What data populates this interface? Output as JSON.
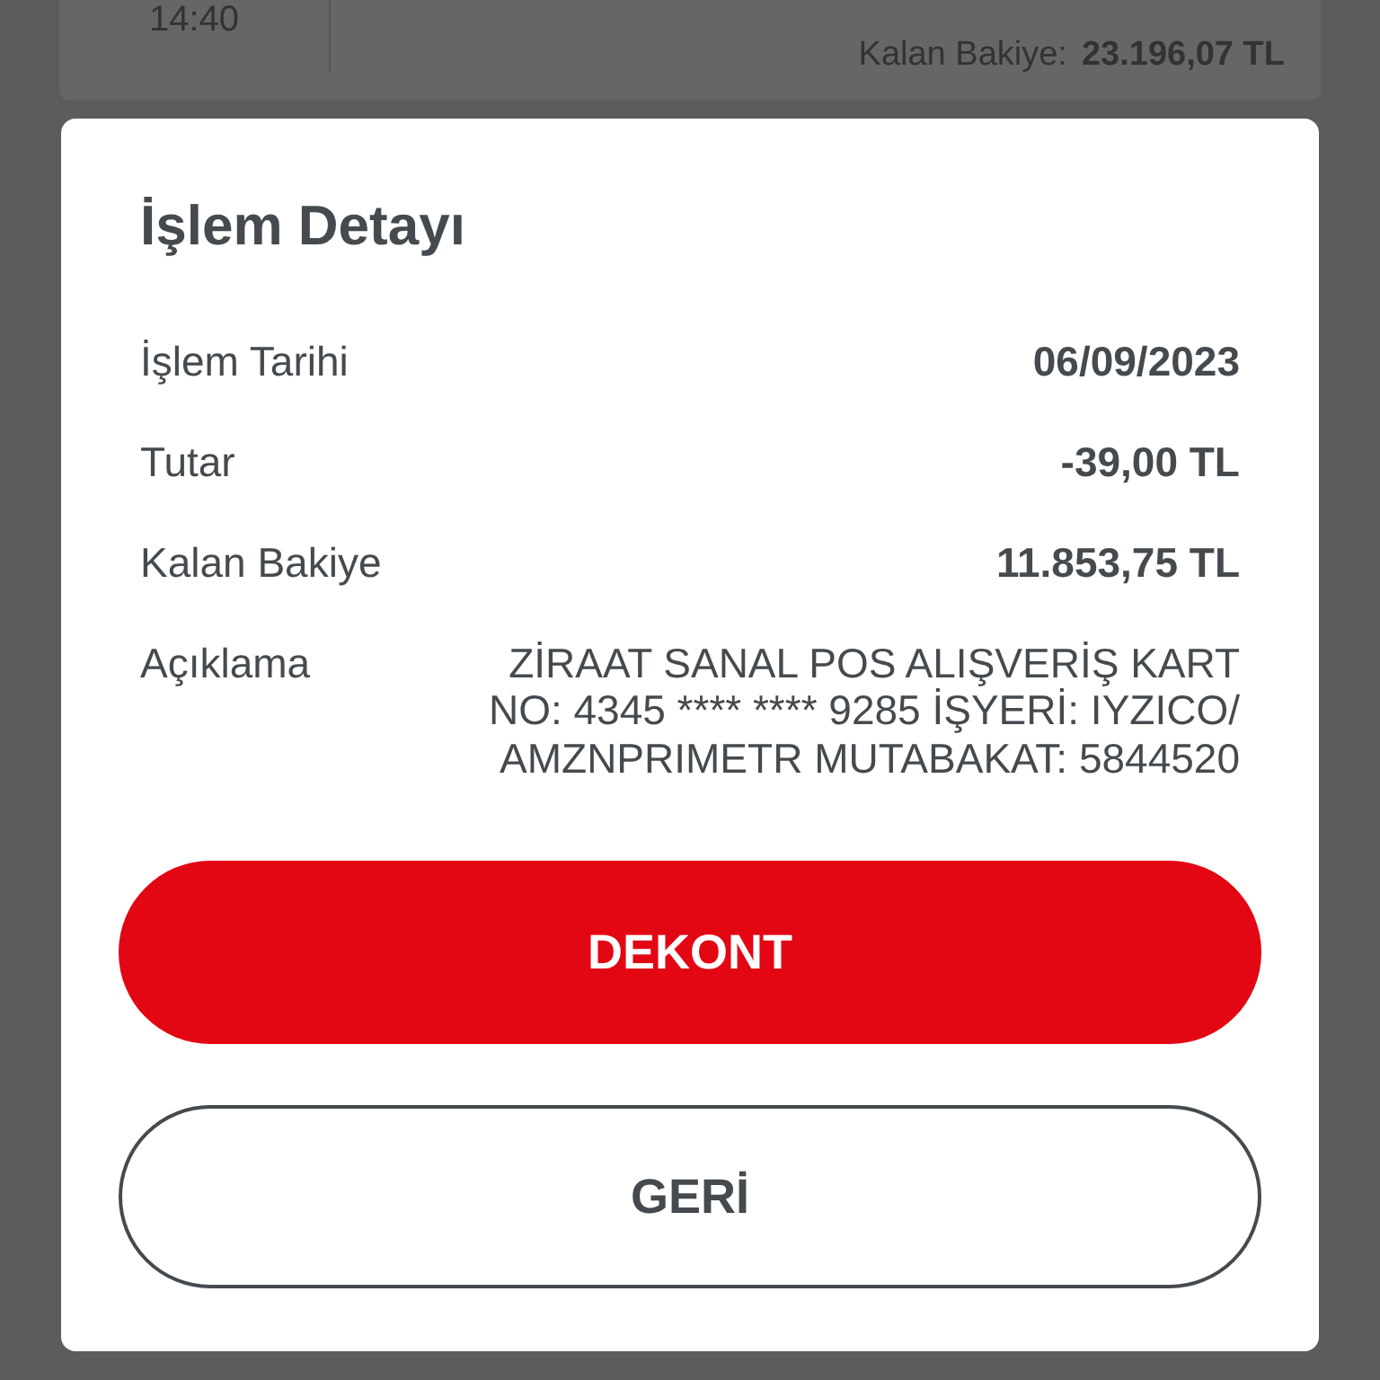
{
  "background_card": {
    "time": "14:40",
    "balance_label": "Kalan Bakiye:",
    "balance_value": "23.196,07 TL"
  },
  "dialog": {
    "title": "İşlem Detayı",
    "rows": [
      {
        "label": "İşlem Tarihi",
        "value": "06/09/2023",
        "kind": "bold"
      },
      {
        "label": "Tutar",
        "value": "-39,00 TL",
        "kind": "bold"
      },
      {
        "label": "Kalan Bakiye",
        "value": "11.853,75 TL",
        "kind": "bold"
      },
      {
        "label": "Açıklama",
        "value": "ZİRAAT SANAL POS ALIŞVERİŞ KART NO: 4345 **** **** 9285 İŞYERİ: IYZICO/ AMZNPRIMETR MUTABAKAT: 5844520",
        "kind": "plain"
      }
    ],
    "buttons": [
      {
        "label": "DEKONT",
        "kind": "primary"
      },
      {
        "label": "GERİ",
        "kind": "outline"
      }
    ]
  }
}
